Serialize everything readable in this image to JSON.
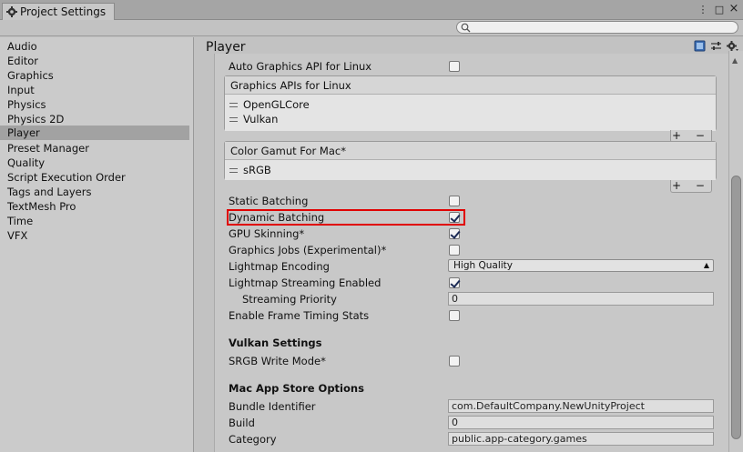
{
  "window": {
    "tab_title": "Project Settings",
    "controls": [
      "⋮",
      "□",
      "×"
    ],
    "search": {
      "placeholder": ""
    }
  },
  "sidebar": {
    "items": [
      {
        "label": "Audio"
      },
      {
        "label": "Editor"
      },
      {
        "label": "Graphics"
      },
      {
        "label": "Input"
      },
      {
        "label": "Physics"
      },
      {
        "label": "Physics 2D"
      },
      {
        "label": "Player",
        "selected": true
      },
      {
        "label": "Preset Manager"
      },
      {
        "label": "Quality"
      },
      {
        "label": "Script Execution Order"
      },
      {
        "label": "Tags and Layers"
      },
      {
        "label": "TextMesh Pro"
      },
      {
        "label": "Time"
      },
      {
        "label": "VFX"
      }
    ]
  },
  "main": {
    "title": "Player",
    "auto_graphics_api_linux": {
      "label": "Auto Graphics API  for Linux",
      "checked": false
    },
    "graphics_apis_linux": {
      "header": "Graphics APIs for Linux",
      "items": [
        "OpenGLCore",
        "Vulkan"
      ],
      "footer": "+ −"
    },
    "color_gamut_mac": {
      "header": "Color Gamut For Mac*",
      "items": [
        "sRGB"
      ],
      "footer": "+ −"
    },
    "static_batching": {
      "label": "Static Batching",
      "checked": false
    },
    "dynamic_batching": {
      "label": "Dynamic Batching",
      "checked": true
    },
    "gpu_skinning": {
      "label": "GPU Skinning*",
      "checked": true
    },
    "graphics_jobs": {
      "label": "Graphics Jobs (Experimental)*",
      "checked": false
    },
    "lightmap_encoding": {
      "label": "Lightmap Encoding",
      "value": "High Quality"
    },
    "lightmap_streaming": {
      "label": "Lightmap Streaming Enabled",
      "checked": true
    },
    "streaming_priority": {
      "label": "Streaming Priority",
      "value": "0"
    },
    "frame_timing": {
      "label": "Enable Frame Timing Stats",
      "checked": false
    },
    "vulkan_settings": {
      "header": "Vulkan Settings"
    },
    "srgb_write_mode": {
      "label": "SRGB Write Mode*",
      "checked": false
    },
    "mac_app_store": {
      "header": "Mac App Store Options"
    },
    "bundle_identifier": {
      "label": "Bundle Identifier",
      "value": "com.DefaultCompany.NewUnityProject"
    },
    "build": {
      "label": "Build",
      "value": "0"
    },
    "category": {
      "label": "Category",
      "value": "public.app-category.games"
    }
  }
}
